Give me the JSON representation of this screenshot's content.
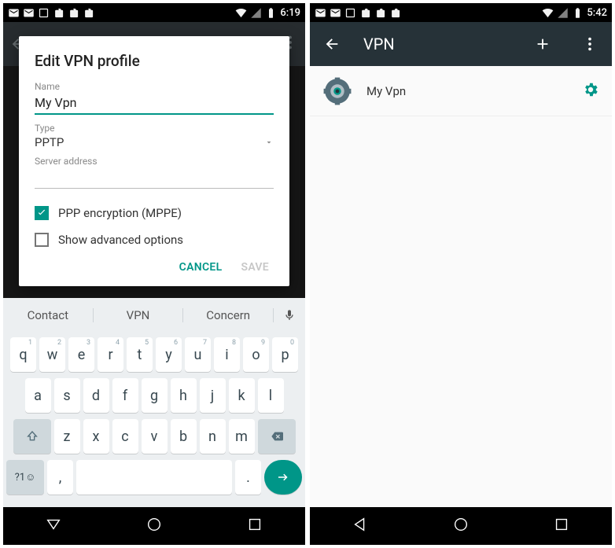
{
  "left": {
    "status_time": "6:19",
    "dialog": {
      "title": "Edit VPN profile",
      "name_label": "Name",
      "name_value": "My Vpn",
      "type_label": "Type",
      "type_value": "PPTP",
      "server_label": "Server address",
      "ppp_label": "PPP encryption (MPPE)",
      "advanced_label": "Show advanced options",
      "cancel": "CANCEL",
      "save": "SAVE"
    },
    "suggestions": [
      "Contact",
      "VPN",
      "Concern"
    ],
    "keys": {
      "row1": [
        [
          "q",
          "1"
        ],
        [
          "w",
          "2"
        ],
        [
          "e",
          "3"
        ],
        [
          "r",
          "4"
        ],
        [
          "t",
          "5"
        ],
        [
          "y",
          "6"
        ],
        [
          "u",
          "7"
        ],
        [
          "i",
          "8"
        ],
        [
          "o",
          "9"
        ],
        [
          "p",
          "0"
        ]
      ],
      "row2": [
        "a",
        "s",
        "d",
        "f",
        "g",
        "h",
        "j",
        "k",
        "l"
      ],
      "row3": [
        "z",
        "x",
        "c",
        "v",
        "b",
        "n",
        "m"
      ],
      "sym": "?1☺",
      "comma": ",",
      "period": "."
    }
  },
  "right": {
    "status_time": "5:42",
    "appbar_title": "VPN",
    "list_item_label": "My Vpn"
  }
}
